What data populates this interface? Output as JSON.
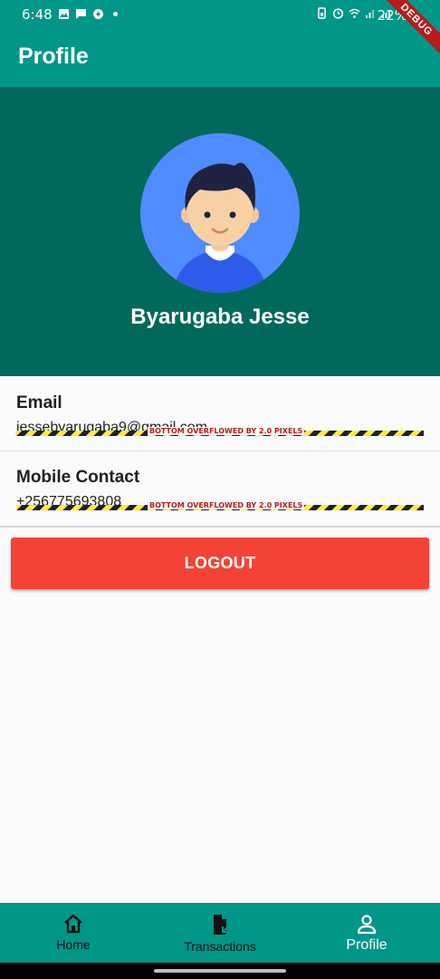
{
  "status_bar": {
    "time": "6:48",
    "battery": "22%",
    "icons": [
      "image-icon",
      "message-icon",
      "app-icon",
      "dot-icon",
      "battery-saver-icon",
      "alarm-icon",
      "wifi-icon",
      "signal-icon",
      "signal-icon"
    ]
  },
  "debug_banner": "DEBUG",
  "app_bar": {
    "title": "Profile"
  },
  "profile": {
    "name": "Byarugaba Jesse",
    "avatar": "avatar-illustration"
  },
  "email": {
    "label": "Email",
    "value": "jessebyarugaba9@gmail.com",
    "overflow_warning": "BOTTOM OVERFLOWED BY 2.0 PIXELS"
  },
  "mobile": {
    "label": "Mobile Contact",
    "value": "+256775693808",
    "overflow_warning": "BOTTOM OVERFLOWED BY 2.0 PIXELS"
  },
  "logout_label": "LOGOUT",
  "bottom_nav": {
    "items": [
      {
        "label": "Home",
        "icon": "home-icon"
      },
      {
        "label": "Transactions",
        "icon": "receipt-icon"
      },
      {
        "label": "Profile",
        "icon": "person-icon",
        "active": true
      }
    ]
  },
  "colors": {
    "primary": "#009688",
    "header": "#00695c",
    "logout": "#f44336",
    "avatar_bg": "#4f8cff"
  }
}
